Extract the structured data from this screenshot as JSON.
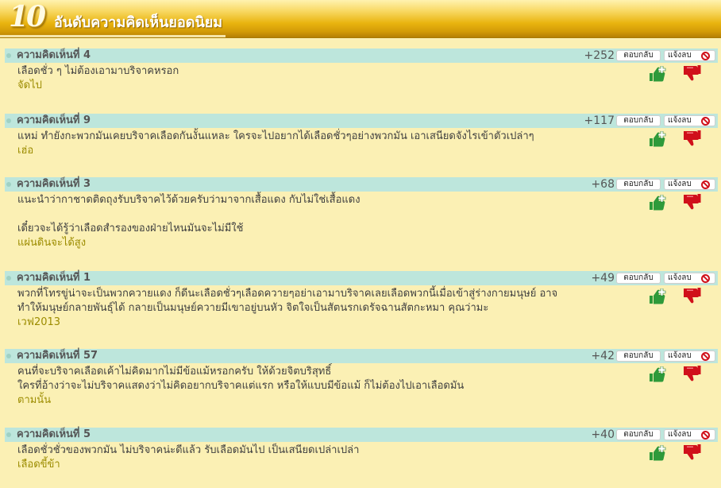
{
  "header": {
    "number": "10",
    "title": "อันดับความคิดเห็นยอดนิยม"
  },
  "buttons": {
    "reply": "ตอบกลับ",
    "report": "แจ้งลบ"
  },
  "icons": {
    "vote_up": "thumbs-up-plus-icon",
    "vote_down": "thumbs-down-icon",
    "report": "no-entry-icon"
  },
  "colors": {
    "title_bar": "#bde6dc",
    "author": "#9c8c00",
    "vote_up": "#2e9a3a",
    "vote_down": "#d0101a"
  },
  "comments": [
    {
      "title": "ความคิดเห็นที่ 4",
      "score": "+252",
      "lines": [
        "เลือดชั่ว ๆ ไม่ต้องเอามาบริจาคหรอก"
      ],
      "author": "จัดไป"
    },
    {
      "title": "ความคิดเห็นที่ 9",
      "score": "+117",
      "lines": [
        "แหม่ ทำยังกะพวกมันเคยบริจาคเลือดกันงั้นแหละ ใครจะไปอยากได้เลือดชั่วๆอย่างพวกมัน เอาเสนียดจังไรเข้าตัวเปล่าๆ"
      ],
      "author": "เฮ่อ"
    },
    {
      "title": "ความคิดเห็นที่ 3",
      "score": "+68",
      "lines": [
        "แนะนำว่ากาชาดติดถุงรับบริจาคไว้ด้วยครับว่ามาจากเสื้อแดง กับไม่ใช่เสื้อแดง",
        "",
        "เดี๋ยวจะได้รู้ว่าเลือดสำรองของฝ่ายไหนมันจะไม่มีใช้"
      ],
      "author": "แผ่นดินจะได้สูง"
    },
    {
      "title": "ความคิดเห็นที่ 1",
      "score": "+49",
      "lines": [
        "พวกที่โทรขู่น่าจะเป็นพวกควายแดง ก็ดีนะเลือดชั่วๆเลือดควายๆอย่าเอามาบริจาคเลยเลือดพวกนี้เมื่อเข้าสู่ร่างกายมนุษย์ อาจ",
        "ทำให้มนุษย์กลายพันธุ์ได้ กลายเป็นมนุษย์ควายมีเขาอยู่บนหัว จิตใจเป็นสัตนรกเดรัจฉานสัตกะหมา คุณว่ามะ"
      ],
      "author": "เวฟ2013"
    },
    {
      "title": "ความคิดเห็นที่ 57",
      "score": "+42",
      "lines": [
        "คนที่จะบริจาคเลือดเค้าไม่คิดมากไม่มีข้อแม้หรอกครับ ให้ด้วยจิตบริสุทธิ์",
        "ใครที่อ้างว่าจะไม่บริจาคแสดงว่าไม่คิดอยากบริจาคแต่แรก หรือให้แบบมีข้อแม้ ก็ไม่ต้องไปเอาเลือดมัน"
      ],
      "author": "ตามนั้น"
    },
    {
      "title": "ความคิดเห็นที่ 5",
      "score": "+40",
      "lines": [
        "เลือดชั่วชั่วของพวกมัน ไม่บริจาคน่ะดีแล้ว รับเลือดมันไป เป็นเสนียดเปล่าเปล่า"
      ],
      "author": "เลือดขี้ข้า"
    }
  ]
}
